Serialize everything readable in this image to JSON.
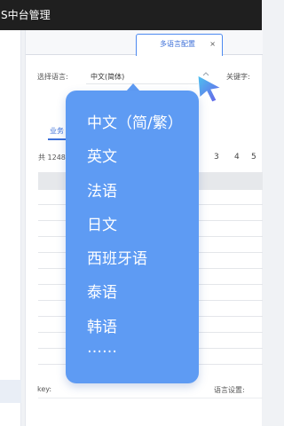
{
  "topbar": {
    "title": "S中台管理"
  },
  "tabs": {
    "active_label": "多语言配置",
    "close_glyph": "×"
  },
  "filters": {
    "language_label": "选择语言:",
    "language_value": "中文(简体)",
    "keyword_label": "关键字:"
  },
  "subtab": {
    "label": "业务"
  },
  "table": {
    "total_text": "共 1248",
    "pages": [
      "3",
      "4",
      "5"
    ]
  },
  "footer": {
    "key_label": "key:",
    "lang_setting_label": "语言设置:"
  },
  "dropdown": {
    "items": [
      "中文（简/繁）",
      "英文",
      "法语",
      "日文",
      "西班牙语",
      "泰语",
      "韩语",
      "……"
    ]
  },
  "colors": {
    "accent": "#3c6fd8",
    "dropdown_bg": "#5e9bf3",
    "topbar_bg": "#1f1f1f"
  }
}
